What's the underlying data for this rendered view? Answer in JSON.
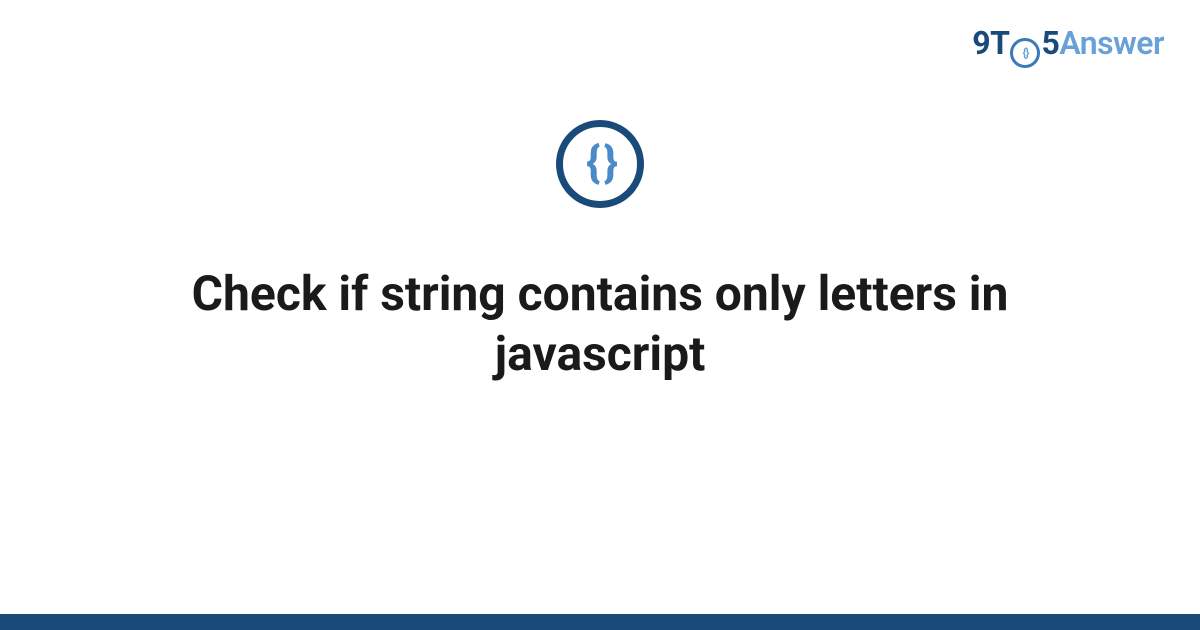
{
  "logo": {
    "part1": "9T",
    "part2": "5",
    "part3": "Answer"
  },
  "icon": {
    "glyph": "{ }"
  },
  "title": "Check if string contains only letters in javascript"
}
